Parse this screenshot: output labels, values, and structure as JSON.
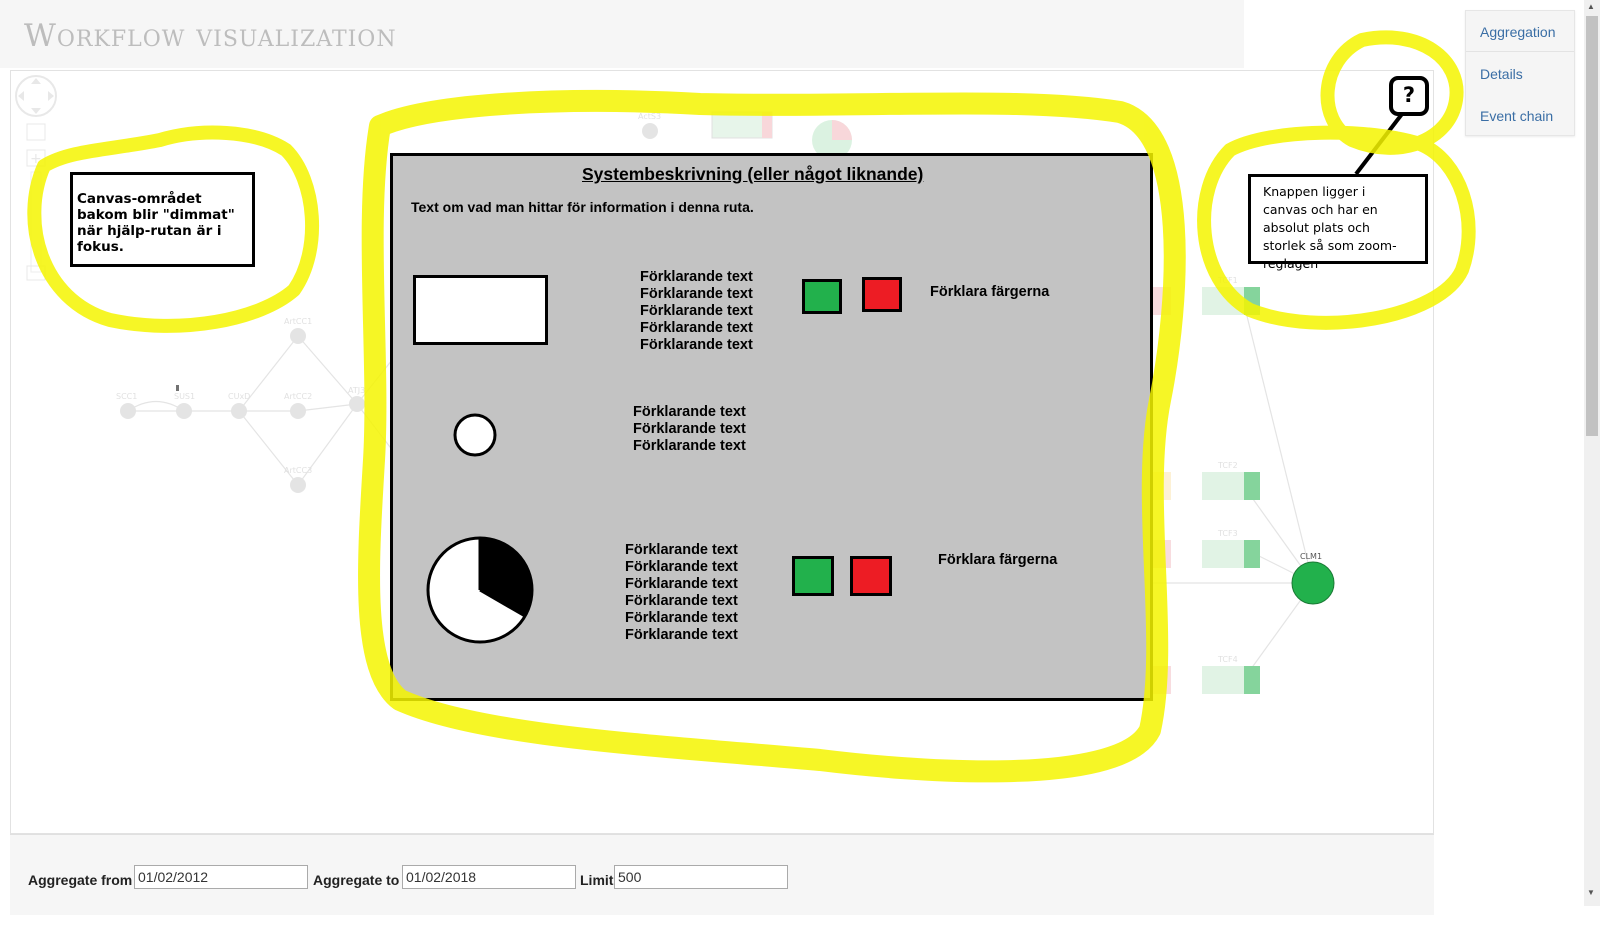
{
  "header": {
    "title": "Workflow visualization"
  },
  "right_nav": {
    "items": [
      "Aggregation",
      "Details",
      "Event chain"
    ]
  },
  "graph": {
    "nodes": [
      "SCC1",
      "SUS1",
      "CUxD",
      "ArtCC1",
      "ArtCC2",
      "ArtCC3",
      "ATJ3",
      "ActS3",
      "TCF1",
      "TCF2",
      "TCF3",
      "TCF4",
      "CLM1"
    ]
  },
  "annotations": {
    "dim_note": "Canvas-området bakom blir \"dimmat\" när hjälp-rutan är i fokus.",
    "button_note": "Knappen ligger i canvas och har en absolut plats och storlek så som zoom-reglagen",
    "help_button": "?"
  },
  "help_panel": {
    "title": "Systembeskrivning (eller något liknande)",
    "intro": "Text om vad man hittar för information i denna ruta.",
    "rect_lines": [
      "Förklarande text",
      "Förklarande text",
      "Förklarande text",
      "Förklarande text",
      "Förklarande text"
    ],
    "circle_lines": [
      "Förklarande text",
      "Förklarande text",
      "Förklarande text"
    ],
    "pie_lines": [
      "Förklarande text",
      "Förklarande text",
      "Förklarande text",
      "Förklarande text",
      "Förklarande text",
      "Förklarande text"
    ],
    "color_label_1": "Förklara färgerna",
    "color_label_2": "Förklara färgerna"
  },
  "aggregation": {
    "from_label": "Aggregate from",
    "from_value": "01/02/2012",
    "to_label": "Aggregate to",
    "to_value": "01/02/2018",
    "limit_label": "Limit",
    "limit_value": "500"
  },
  "colors": {
    "green": "#22b14c",
    "red": "#ed1c24",
    "highlight": "#f5f500",
    "panel": "#c3c3c3"
  }
}
